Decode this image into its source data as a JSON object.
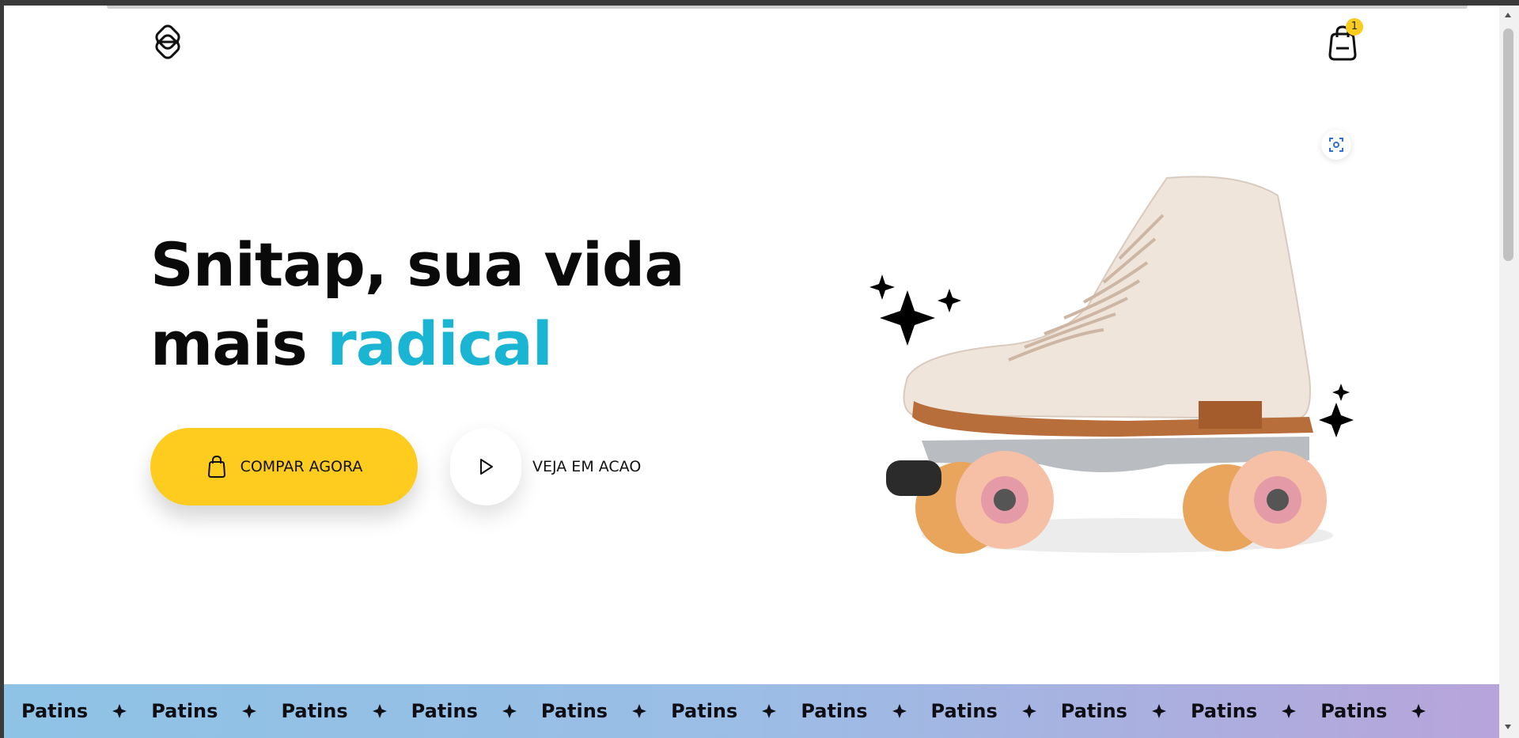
{
  "header": {
    "logo_icon": "diamond-knot-logo",
    "cart_icon": "shopping-bag-icon",
    "cart_count": "1"
  },
  "hero": {
    "headline_line1": "Snitap, sua vida",
    "headline_line2_prefix": "mais ",
    "headline_accent": "radical",
    "buy_button_label": "COMPAR AGORA",
    "watch_button_label": "VEJA EM ACAO",
    "scan_icon": "screen-capture-icon",
    "product_image": "roller-skate"
  },
  "marquee": {
    "items": [
      "Patins",
      "Patins",
      "Patins",
      "Patins",
      "Patins",
      "Patins",
      "Patins",
      "Patins",
      "Patins",
      "Patins",
      "Patins"
    ]
  },
  "colors": {
    "accent": "#19b5d3",
    "button_yellow": "#fdcc1f",
    "text": "#0a0a0a"
  }
}
